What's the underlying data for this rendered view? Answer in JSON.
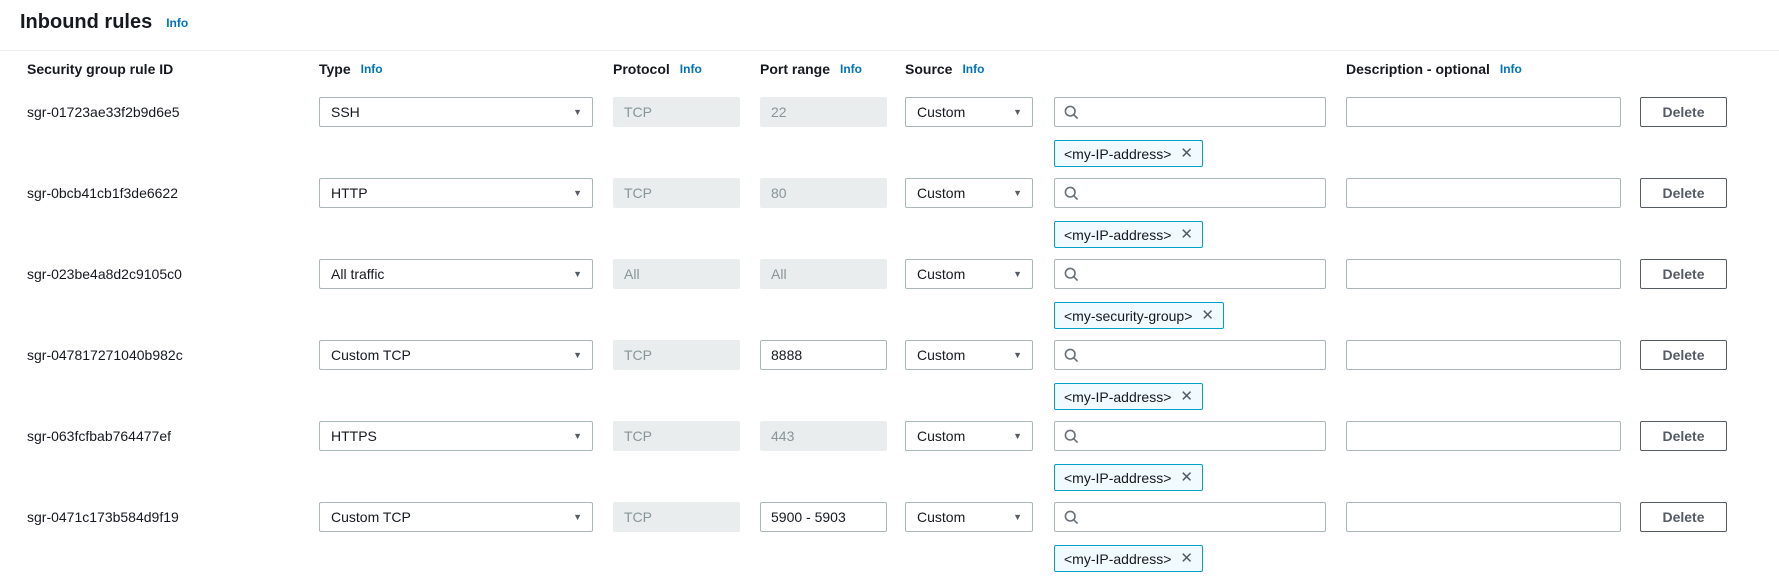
{
  "header": {
    "title": "Inbound rules",
    "info_label": "Info"
  },
  "columns": {
    "rule_id": "Security group rule ID",
    "type": "Type",
    "protocol": "Protocol",
    "port_range": "Port range",
    "source": "Source",
    "description": "Description - optional",
    "info_label": "Info"
  },
  "actions": {
    "delete_label": "Delete"
  },
  "colors": {
    "accent_link_blue": "#0073bb",
    "token_border": "#00a1c9",
    "token_background": "#f1faff",
    "field_border": "#aab7b8",
    "disabled_background": "#eaeded",
    "disabled_text": "#879596",
    "text_dark": "#16191f",
    "button_border": "#545b64"
  },
  "rules": [
    {
      "id": "sgr-01723ae33f2b9d6e5",
      "type": "SSH",
      "protocol": "TCP",
      "port_range": "22",
      "port_editable": false,
      "source_mode": "Custom",
      "source_token": "<my-IP-address>",
      "description": ""
    },
    {
      "id": "sgr-0bcb41cb1f3de6622",
      "type": "HTTP",
      "protocol": "TCP",
      "port_range": "80",
      "port_editable": false,
      "source_mode": "Custom",
      "source_token": "<my-IP-address>",
      "description": ""
    },
    {
      "id": "sgr-023be4a8d2c9105c0",
      "type": "All traffic",
      "protocol": "All",
      "port_range": "All",
      "port_editable": false,
      "source_mode": "Custom",
      "source_token": "<my-security-group>",
      "description": ""
    },
    {
      "id": "sgr-047817271040b982c",
      "type": "Custom TCP",
      "protocol": "TCP",
      "port_range": "8888",
      "port_editable": true,
      "source_mode": "Custom",
      "source_token": "<my-IP-address>",
      "description": ""
    },
    {
      "id": "sgr-063fcfbab764477ef",
      "type": "HTTPS",
      "protocol": "TCP",
      "port_range": "443",
      "port_editable": false,
      "source_mode": "Custom",
      "source_token": "<my-IP-address>",
      "description": ""
    },
    {
      "id": "sgr-0471c173b584d9f19",
      "type": "Custom TCP",
      "protocol": "TCP",
      "port_range": "5900 - 5903",
      "port_editable": true,
      "source_mode": "Custom",
      "source_token": "<my-IP-address>",
      "description": ""
    }
  ]
}
